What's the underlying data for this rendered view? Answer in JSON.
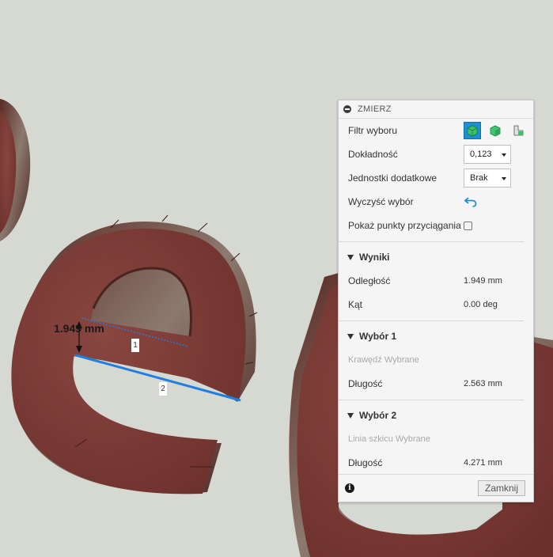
{
  "viewport": {
    "measurement_label": "1.949 mm",
    "edge_tags": [
      "1",
      "2"
    ]
  },
  "panel": {
    "title": "ZMIERZ",
    "filter_label": "Filtr wyboru",
    "filter_icons": [
      "body-select-icon",
      "face-select-icon",
      "edge-select-icon"
    ],
    "precision_label": "Dokładność",
    "precision_value": "0,123",
    "secondary_units_label": "Jednostki dodatkowe",
    "secondary_units_value": "Brak",
    "clear_selection_label": "Wyczyść wybór",
    "snap_points_label": "Pokaż punkty przyciągania",
    "snap_points_checked": false,
    "results": {
      "heading": "Wyniki",
      "distance_label": "Odległość",
      "distance_value": "1.949 mm",
      "angle_label": "Kąt",
      "angle_value": "0.00 deg"
    },
    "selection1": {
      "heading": "Wybór 1",
      "status": "Krawędź Wybrane",
      "length_label": "Długość",
      "length_value": "2.563 mm"
    },
    "selection2": {
      "heading": "Wybór 2",
      "status": "Linia szkicu Wybrane",
      "length_label": "Długość",
      "length_value": "4.271 mm"
    },
    "close_label": "Zamknij"
  },
  "colors": {
    "background": "#d6d9d2",
    "model_face": "#7a3b35",
    "highlight_edge": "#1e7fe0",
    "accent": "#1d8fd1"
  }
}
